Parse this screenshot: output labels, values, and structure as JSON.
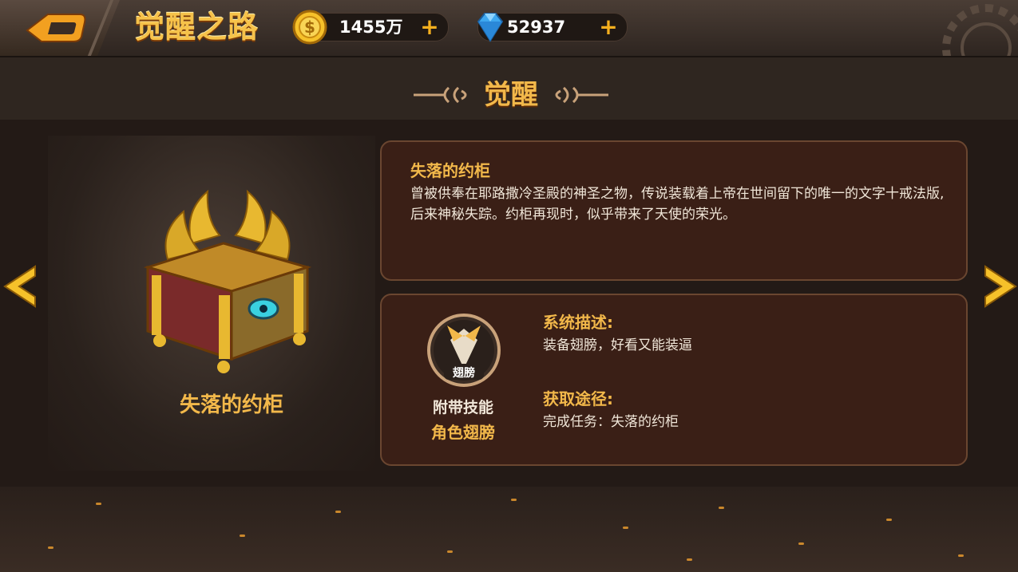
{
  "header": {
    "title": "觉醒之路",
    "gold": {
      "icon": "coin-icon",
      "value": "1455万",
      "plus": "+"
    },
    "diamond": {
      "icon": "diamond-icon",
      "value": "52937",
      "plus": "+"
    }
  },
  "section": {
    "title": "觉醒"
  },
  "item": {
    "name": "失落的约柜",
    "desc_title": "失落的约柜",
    "desc_text": "曾被供奉在耶路撒冷圣殿的神圣之物，传说装载着上帝在世间留下的唯一的文字十戒法版,后来神秘失踪。约柜再现时，似乎带来了天使的荣光。"
  },
  "skill": {
    "icon_label": "翅膀",
    "label": "附带技能",
    "name": "角色翅膀"
  },
  "system": {
    "title": "系统描述:",
    "text": "装备翅膀，好看又能装逼"
  },
  "obtain": {
    "title": "获取途径:",
    "text": "完成任务：失落的约柜"
  },
  "colors": {
    "accent": "#f2b84a",
    "panel": "#3a1f16",
    "border": "#6a4630"
  }
}
